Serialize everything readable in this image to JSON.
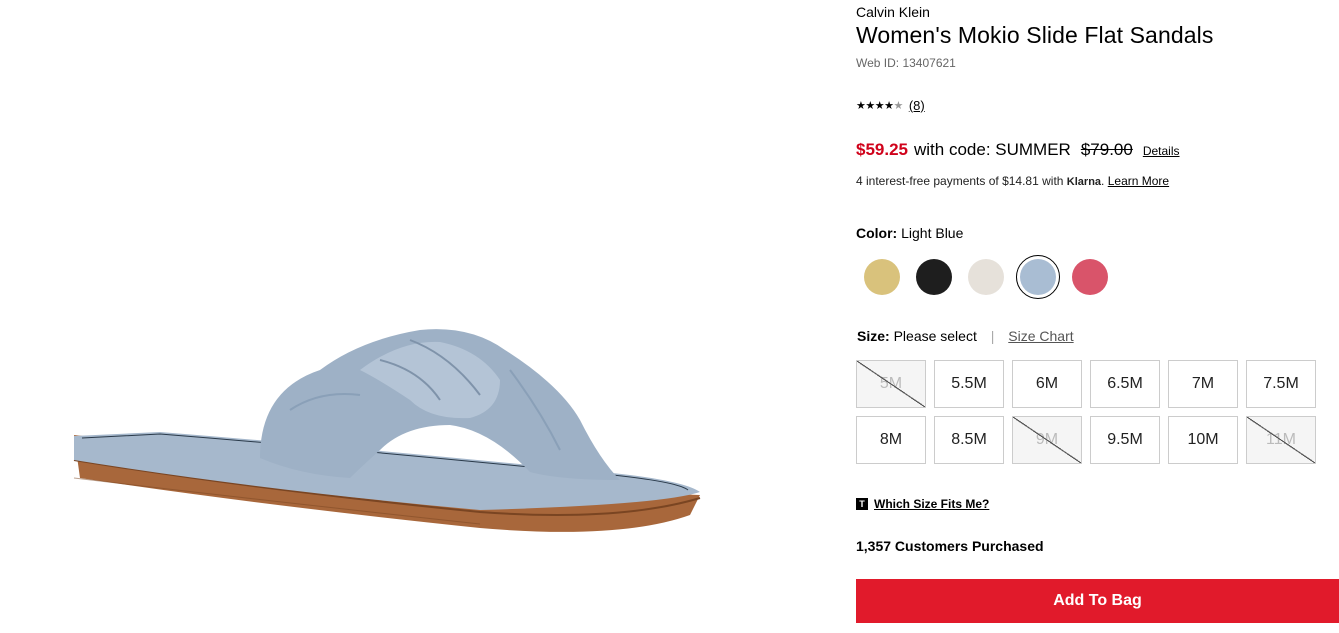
{
  "product": {
    "brand": "Calvin Klein",
    "title": "Women's Mokio Slide Flat Sandals",
    "web_id": "Web ID: 13407621",
    "image_color": "#a6b8cc"
  },
  "rating": {
    "stars_filled": "★★★★",
    "stars_empty": "★",
    "count": "(8)"
  },
  "price": {
    "sale": "$59.25",
    "promo": "with code: SUMMER",
    "original": "$79.00",
    "details_label": "Details",
    "sale_color": "#d0021b"
  },
  "installments": {
    "text": "4 interest-free payments of $14.81 with",
    "provider": "Klarna",
    "punct": ".",
    "learn_more": "Learn More"
  },
  "color": {
    "label": "Color:",
    "selected": "Light Blue",
    "swatches": [
      {
        "name": "Gold",
        "hex": "#d9c27c"
      },
      {
        "name": "Black",
        "hex": "#1e1e1e"
      },
      {
        "name": "Cream",
        "hex": "#e6e1da"
      },
      {
        "name": "Light Blue",
        "hex": "#a9bdd3",
        "selected": true
      },
      {
        "name": "Pink",
        "hex": "#d9546a"
      }
    ]
  },
  "size": {
    "label": "Size:",
    "value": "Please select",
    "separator": "|",
    "chart_label": "Size Chart",
    "options": [
      {
        "label": "5M",
        "available": false
      },
      {
        "label": "5.5M",
        "available": true
      },
      {
        "label": "6M",
        "available": true
      },
      {
        "label": "6.5M",
        "available": true
      },
      {
        "label": "7M",
        "available": true
      },
      {
        "label": "7.5M",
        "available": true
      },
      {
        "label": "8M",
        "available": true
      },
      {
        "label": "8.5M",
        "available": true
      },
      {
        "label": "9M",
        "available": false
      },
      {
        "label": "9.5M",
        "available": true
      },
      {
        "label": "10M",
        "available": true
      },
      {
        "label": "11M",
        "available": false
      }
    ]
  },
  "fit": {
    "icon_letter": "T",
    "label": "Which Size Fits Me?"
  },
  "purchased": "1,357 Customers Purchased",
  "add_to_bag": {
    "label": "Add To Bag",
    "color": "#e11a2b"
  }
}
